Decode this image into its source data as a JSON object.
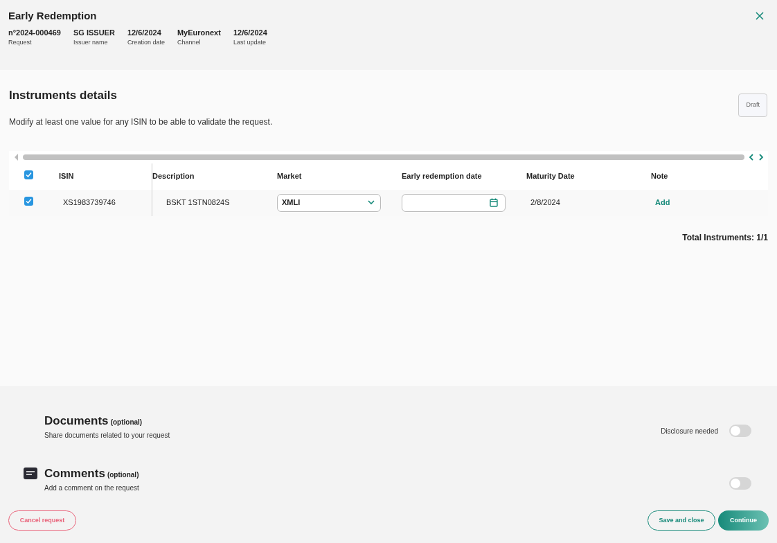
{
  "header": {
    "title": "Early Redemption",
    "meta": [
      {
        "value": "n°2024-000469",
        "label": "Request"
      },
      {
        "value": "SG ISSUER",
        "label": "Issuer name"
      },
      {
        "value": "12/6/2024",
        "label": "Creation date"
      },
      {
        "value": "MyEuronext",
        "label": "Channel"
      },
      {
        "value": "12/6/2024",
        "label": "Last update"
      }
    ]
  },
  "instruments": {
    "title": "Instruments details",
    "status": "Draft",
    "hint": "Modify at least one value for any ISIN to be able to validate the request.",
    "table": {
      "all_checked": true,
      "columns": [
        "ISIN",
        "Description",
        "Market",
        "Early redemption date",
        "Maturity Date",
        "Note"
      ],
      "rows": [
        {
          "selected": true,
          "isin": "XS1983739746",
          "description": "BSKT 1STN0824S",
          "market": "XMLI",
          "maturity_date": "2/8/2024",
          "note_action": "Add"
        }
      ]
    },
    "total": "Total Instruments: 1/1"
  },
  "sections": [
    {
      "kind": "documents",
      "title": "Documents",
      "optional": "(optional)",
      "description": "Share documents related to your request",
      "toggle": {
        "label": "Disclosure needed",
        "on": false
      }
    },
    {
      "kind": "comments",
      "title": "Comments",
      "optional": "(optional)",
      "description": "Add a comment on the request",
      "toggle": {
        "on": false
      }
    }
  ],
  "footer": {
    "cancel": "Cancel request",
    "save": "Save and close",
    "continue": "Continue"
  }
}
